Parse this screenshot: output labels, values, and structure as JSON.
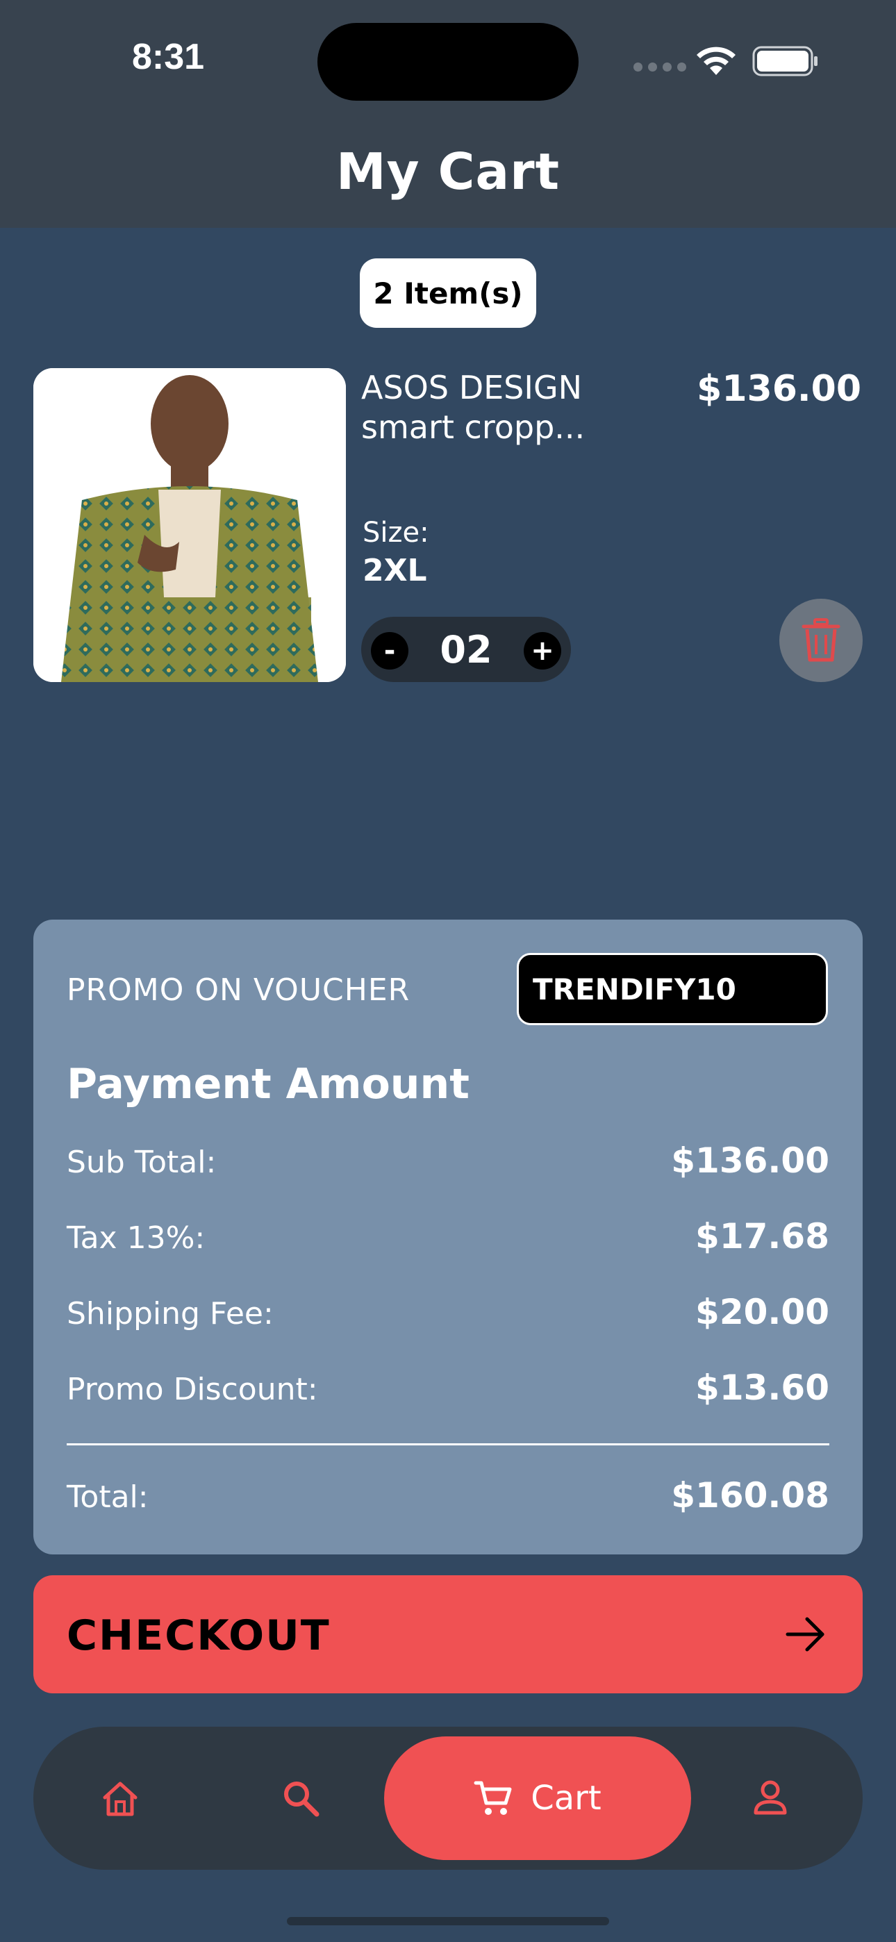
{
  "status_bar": {
    "time": "8:31"
  },
  "header": {
    "title": "My Cart"
  },
  "cart": {
    "count_label": "2 Item(s)"
  },
  "item": {
    "name": "ASOS DESIGN smart cropp...",
    "price": "$136.00",
    "size_label": "Size:",
    "size_value": "2XL",
    "quantity": "02",
    "minus_label": "-",
    "plus_label": "+"
  },
  "summary": {
    "promo_label": "PROMO ON VOUCHER",
    "promo_code": "TRENDIFY10",
    "heading": "Payment Amount",
    "rows": [
      {
        "label": "Sub Total:",
        "value": "$136.00"
      },
      {
        "label": "Tax 13%:",
        "value": "$17.68"
      },
      {
        "label": "Shipping Fee:",
        "value": "$20.00"
      },
      {
        "label": "Promo Discount:",
        "value": "$13.60"
      }
    ],
    "total_label": "Total:",
    "total_value": "$160.08"
  },
  "checkout": {
    "label": "CHECKOUT",
    "icon": "arrow-right-icon"
  },
  "nav": {
    "items": [
      {
        "icon": "home-icon"
      },
      {
        "icon": "search-icon"
      },
      {
        "icon": "cart-icon",
        "label": "Cart"
      },
      {
        "icon": "profile-icon"
      }
    ]
  },
  "colors": {
    "background": "#324861",
    "header": "#38434f",
    "accent": "#f05153",
    "summary_card": "#7890aa",
    "navbar": "#2f3943"
  }
}
